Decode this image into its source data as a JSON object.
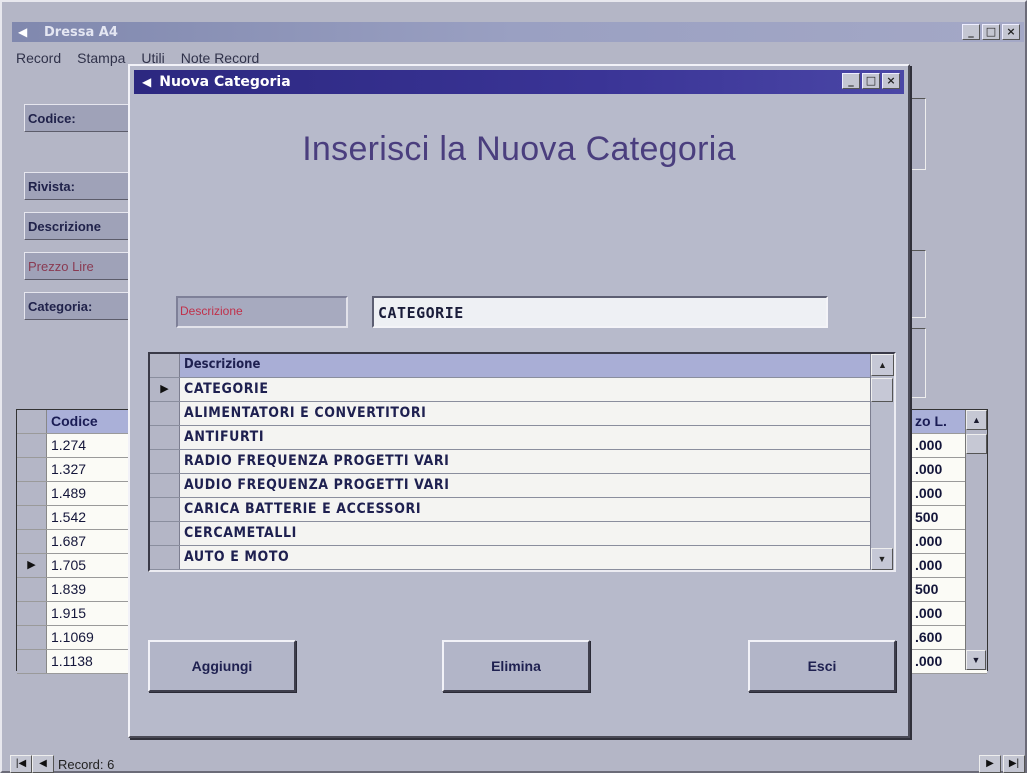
{
  "main_window": {
    "title": "Dressa A4",
    "menu": [
      "Record",
      "Stampa",
      "Utili",
      "Note Record"
    ],
    "field_labels": [
      "Codice:",
      "Rivista:",
      "Descrizione",
      "Prezzo Lire",
      "Categoria:"
    ],
    "grid": {
      "header": "Codice",
      "rows": [
        "1.274",
        "1.327",
        "1.489",
        "1.542",
        "1.687",
        "1.705",
        "1.839",
        "1.915",
        "1.1069",
        "1.1138"
      ],
      "current_row_index": 5
    },
    "grid_right": {
      "header": "zo L.",
      "rows": [
        ".000",
        ".000",
        ".000",
        "500",
        ".000",
        ".000",
        "500",
        ".000",
        ".600",
        ".000"
      ]
    },
    "status": {
      "record_label": "Record: 6"
    }
  },
  "dialog": {
    "title": "Nuova Categoria",
    "heading": "Inserisci la Nuova Categoria",
    "description_label": "Descrizione",
    "description_value": "CATEGORIE",
    "list": {
      "header": "Descrizione",
      "rows": [
        "CATEGORIE",
        "ALIMENTATORI E CONVERTITORI",
        "ANTIFURTI",
        "RADIO FREQUENZA PROGETTI VARI",
        "AUDIO FREQUENZA PROGETTI VARI",
        "CARICA BATTERIE E ACCESSORI",
        "CERCAMETALLI",
        "AUTO E MOTO"
      ],
      "current_row_index": 0
    },
    "buttons": {
      "add": "Aggiungi",
      "delete": "Elimina",
      "exit": "Esci"
    }
  },
  "colors": {
    "dialog_titlebar": "#2c2880",
    "heading": "#4a3e7e",
    "label_red": "#c0304a",
    "window_bg": "#b7bacb"
  }
}
